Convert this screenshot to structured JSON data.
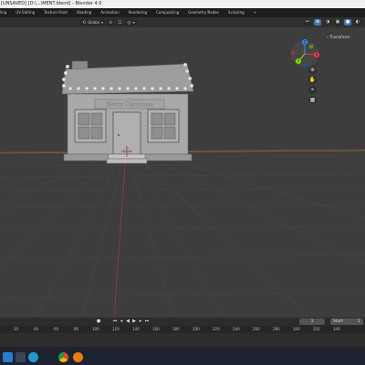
{
  "window": {
    "title": "[UNSAVED] [D:\\...\\MENT.blend] - Blender 4.0"
  },
  "workspace_tabs": [
    "ling",
    "UV Editing",
    "Texture Paint",
    "Shading",
    "Animation",
    "Rendering",
    "Compositing",
    "Geometry Nodes",
    "Scripting",
    "+"
  ],
  "viewport_header": {
    "transform_orientation": "Global"
  },
  "viewport": {
    "transform_tab": "Transform",
    "gizmo_axes": {
      "x": "X",
      "y": "Y",
      "z": "Z"
    },
    "sign_text": "Merry Christmas"
  },
  "timeline": {
    "current_frame": "1",
    "start_label": "Start",
    "start_value": "1",
    "ruler_ticks": [
      "20",
      "40",
      "60",
      "80",
      "100",
      "120",
      "140",
      "160",
      "180",
      "200",
      "220",
      "240",
      "260",
      "280",
      "300",
      "320",
      "340"
    ]
  },
  "colors": {
    "accent_blue": "#4772b3",
    "axis_x": "#ff3352",
    "axis_y": "#8bdc00",
    "axis_z": "#2890ff",
    "viewport_bg": "#3d3d3d"
  },
  "taskbar": {
    "icons": [
      "start-icon",
      "search-icon",
      "edge-icon",
      "chrome-icon",
      "blender-icon"
    ]
  }
}
